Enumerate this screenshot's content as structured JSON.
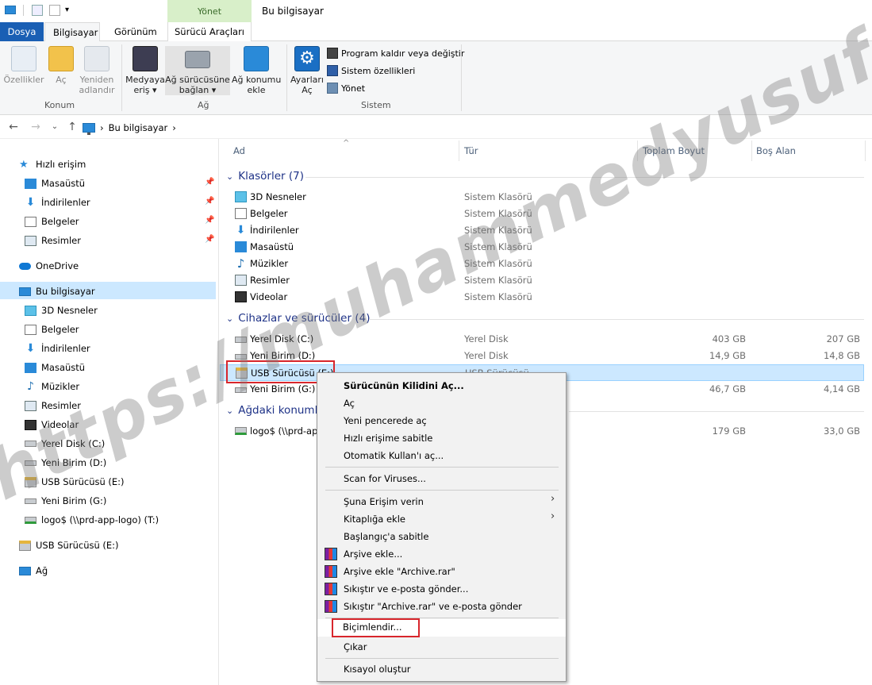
{
  "quick_access": {
    "title": "Bu bilgisayar",
    "context_tab_group": "Yönet"
  },
  "tabs": [
    "Dosya",
    "Bilgisayar",
    "Görünüm",
    "Sürücü Araçları"
  ],
  "ribbon": {
    "konum": {
      "label": "Konum",
      "buttons": [
        "Özellikler",
        "Aç",
        "Yeniden\nadlandır"
      ]
    },
    "ag": {
      "label": "Ağ",
      "buttons": [
        "Medyaya\neriş ▾",
        "Ağ sürücüsüne\nbağlan ▾",
        "Ağ konumu\nekle"
      ]
    },
    "sistem": {
      "label": "Sistem",
      "big_button": "Ayarları\nAç",
      "small_buttons": [
        "Program kaldır veya değiştir",
        "Sistem özellikleri",
        "Yönet"
      ]
    }
  },
  "address": {
    "path": "Bu bilgisayar",
    "sep": "›"
  },
  "nav": {
    "quick": "Hızlı erişim",
    "quick_items": [
      "Masaüstü",
      "İndirilenler",
      "Belgeler",
      "Resimler"
    ],
    "onedrive": "OneDrive",
    "this_pc": "Bu bilgisayar",
    "pc_items": [
      "3D Nesneler",
      "Belgeler",
      "İndirilenler",
      "Masaüstü",
      "Müzikler",
      "Resimler",
      "Videolar",
      "Yerel Disk (C:)",
      "Yeni Birim (D:)",
      "USB Sürücüsü (E:)",
      "Yeni Birim (G:)",
      "logo$ (\\\\prd-app-logo) (T:)"
    ],
    "usb": "USB Sürücüsü (E:)",
    "network": "Ağ"
  },
  "columns": {
    "name": "Ad",
    "type": "Tür",
    "total": "Toplam Boyut",
    "free": "Boş Alan"
  },
  "groups": {
    "folders": {
      "title": "Klasörler (7)",
      "items": [
        {
          "name": "3D Nesneler",
          "type": "Sistem Klasörü"
        },
        {
          "name": "Belgeler",
          "type": "Sistem Klasörü"
        },
        {
          "name": "İndirilenler",
          "type": "Sistem Klasörü"
        },
        {
          "name": "Masaüstü",
          "type": "Sistem Klasörü"
        },
        {
          "name": "Müzikler",
          "type": "Sistem Klasörü"
        },
        {
          "name": "Resimler",
          "type": "Sistem Klasörü"
        },
        {
          "name": "Videolar",
          "type": "Sistem Klasörü"
        }
      ]
    },
    "devices": {
      "title": "Cihazlar ve sürücüler (4)",
      "items": [
        {
          "name": "Yerel Disk (C:)",
          "type": "Yerel Disk",
          "total": "403 GB",
          "free": "207 GB"
        },
        {
          "name": "Yeni Birim (D:)",
          "type": "Yerel Disk",
          "total": "14,9 GB",
          "free": "14,8 GB"
        },
        {
          "name": "USB Sürücüsü (E:)",
          "type": "USB Sürücüsü",
          "total": "",
          "free": ""
        },
        {
          "name": "Yeni Birim (G:)",
          "type": "",
          "total": "46,7 GB",
          "free": "4,14 GB"
        }
      ]
    },
    "network": {
      "title": "Ağdaki konuml",
      "items": [
        {
          "name": "logo$ (\\\\prd-ap",
          "type": "",
          "total": "179 GB",
          "free": "33,0 GB"
        }
      ]
    }
  },
  "context_menu": {
    "items": [
      "Sürücünün Kilidini Aç...",
      "Aç",
      "Yeni pencerede aç",
      "Hızlı erişime sabitle",
      "Otomatik Kullan'ı aç...",
      "Scan for Viruses...",
      "Şuna Erişim verin",
      "Kitaplığa ekle",
      "Başlangıç'a sabitle",
      "Arşive ekle...",
      "Arşive ekle \"Archive.rar\"",
      "Sıkıştır ve e-posta gönder...",
      "Sıkıştır \"Archive.rar\" ve e-posta gönder",
      "Biçimlendir...",
      "Çıkar",
      "Kısayol oluştur"
    ],
    "arrow": "›"
  },
  "watermark": "https://muhammedyusufolgun.blogspot.com",
  "colors": {
    "accent": "#1a5fb4",
    "selection": "#cce8ff",
    "highlight_box": "#d8262c",
    "group_header": "#1e3287"
  }
}
